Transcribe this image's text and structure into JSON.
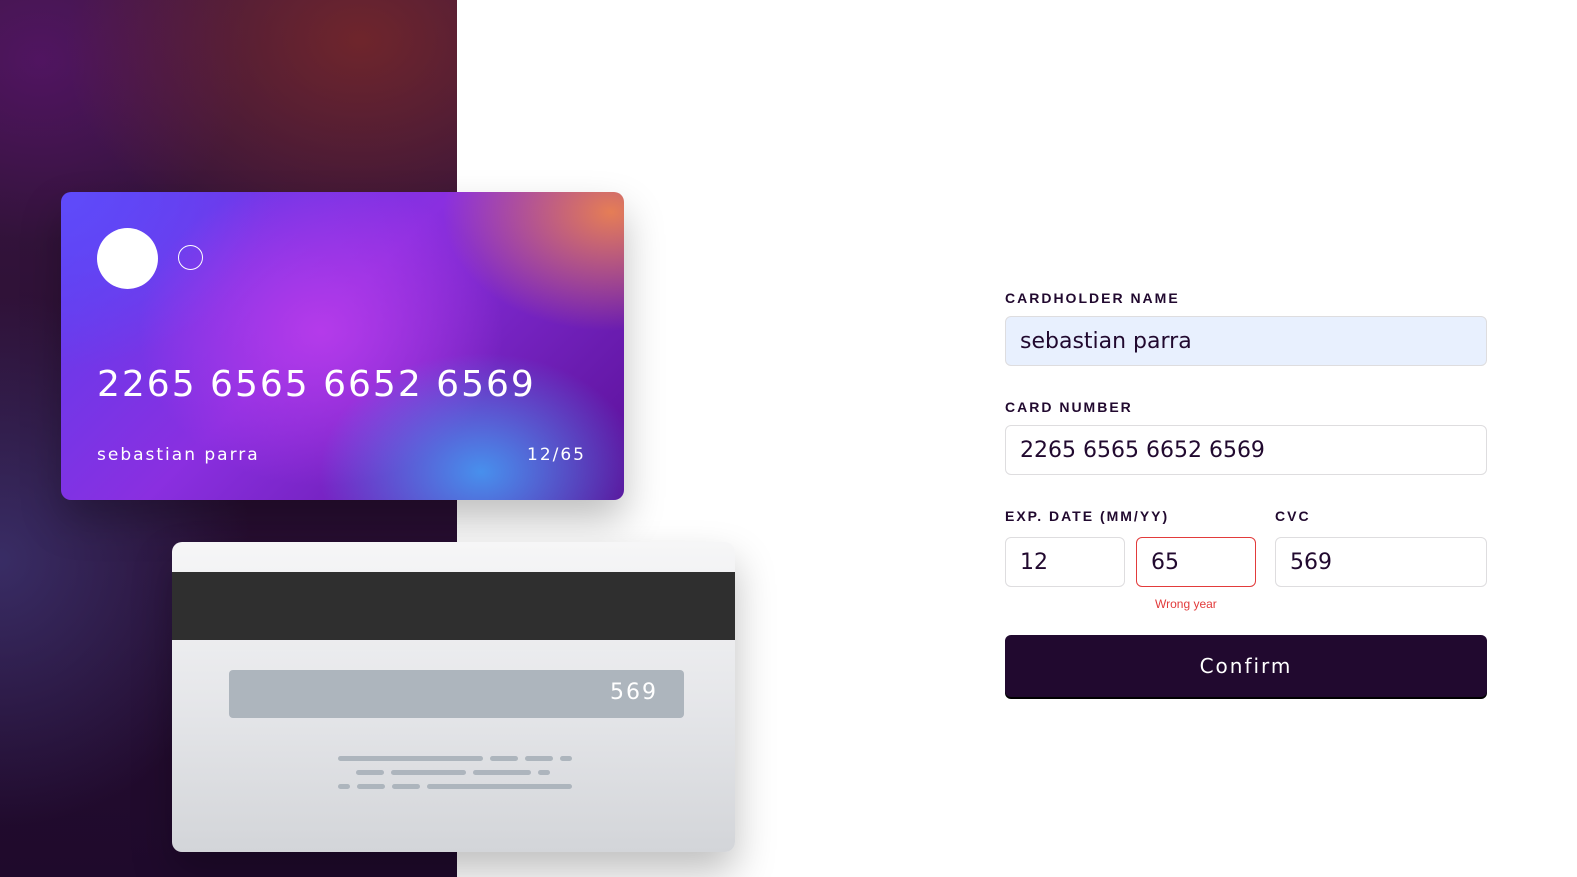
{
  "card_front": {
    "number": "2265 6565 6652 6569",
    "holder_name": "sebastian parra",
    "expiry": "12/65"
  },
  "card_back": {
    "cvc": "569"
  },
  "form": {
    "cardholder_label": "CARDHOLDER NAME",
    "cardholder_value": "sebastian parra",
    "card_number_label": "CARD NUMBER",
    "card_number_value": "2265 6565 6652 6569",
    "exp_label": "EXP. DATE (MM/YY)",
    "exp_month_value": "12",
    "exp_year_value": "65",
    "cvc_label": "CVC",
    "cvc_value": "569",
    "error_year": "Wrong year",
    "confirm_label": "Confirm"
  },
  "colors": {
    "accent": "#21092f",
    "error": "#e23b3b",
    "autofill_bg": "#e8f0fe"
  }
}
